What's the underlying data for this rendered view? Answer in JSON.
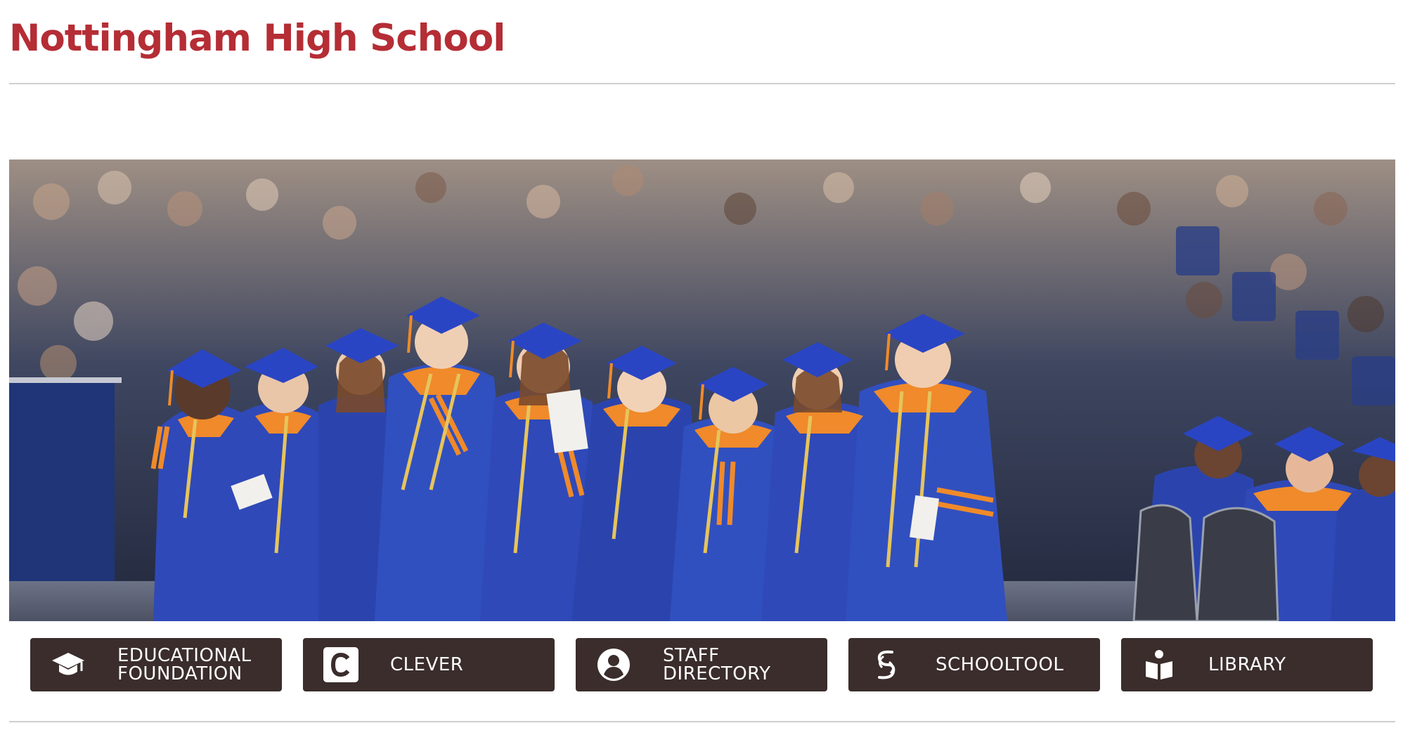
{
  "site": {
    "title": "Nottingham High School"
  },
  "hero": {
    "image_alt": "Graduates in blue caps and gowns with orange trim standing in a row at commencement"
  },
  "quick_links": [
    {
      "label": "Educational\nFoundation",
      "icon": "graduation-cap-icon"
    },
    {
      "label": "Clever",
      "icon": "clever-logo-icon"
    },
    {
      "label": "Staff\nDirectory",
      "icon": "user-circle-icon"
    },
    {
      "label": "SchoolTool",
      "icon": "schooltool-logo-icon"
    },
    {
      "label": "Library",
      "icon": "book-reader-icon"
    }
  ],
  "colors": {
    "title": "#b52d35",
    "button_bg": "#3a2d2c",
    "button_text": "#ffffff",
    "gown_blue": "#2f49b8",
    "gown_orange": "#f08a2a"
  }
}
